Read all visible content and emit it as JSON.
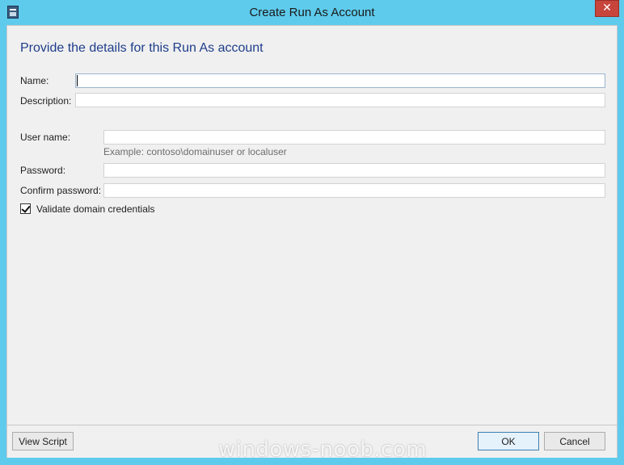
{
  "window": {
    "title": "Create Run As Account",
    "close_glyph": "✕"
  },
  "form": {
    "heading": "Provide the details for this Run As account",
    "name_label": "Name:",
    "name_value": "",
    "description_label": "Description:",
    "description_value": "",
    "username_label": "User name:",
    "username_value": "",
    "username_hint": "Example: contoso\\domainuser or localuser",
    "password_label": "Password:",
    "password_value": "",
    "confirm_label": "Confirm password:",
    "confirm_value": "",
    "validate_label": "Validate domain credentials",
    "validate_checked": true
  },
  "footer": {
    "view_script_label": "View Script",
    "ok_label": "OK",
    "cancel_label": "Cancel"
  },
  "watermark": "windows-noob.com",
  "colors": {
    "titlebar": "#5ecbec",
    "heading": "#1e3d8a",
    "close_button": "#c7453b"
  }
}
